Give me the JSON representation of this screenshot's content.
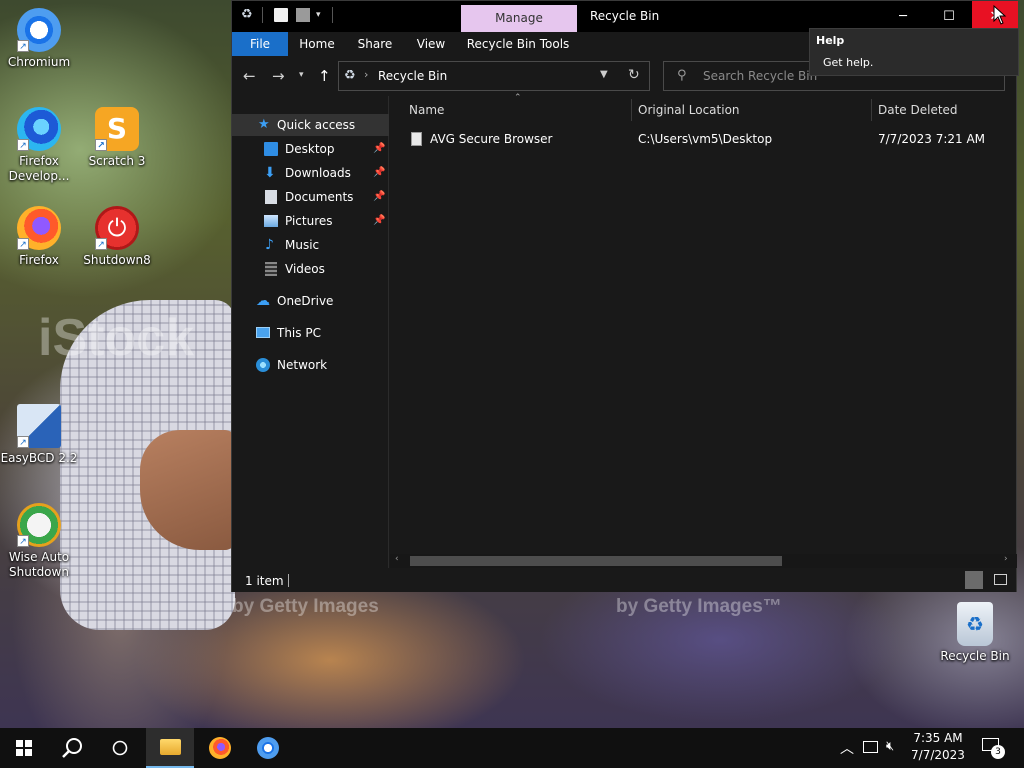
{
  "desktop": {
    "icons": [
      {
        "label": "Chromium"
      },
      {
        "label": "Firefox Develop..."
      },
      {
        "label": "Scratch 3"
      },
      {
        "label": "Firefox"
      },
      {
        "label": "Shutdown8"
      },
      {
        "label": "EasyBCD 2.2"
      },
      {
        "label": "Wise Auto Shutdown"
      },
      {
        "label": "Recycle Bin"
      }
    ],
    "watermarks": [
      "iStock",
      "by Getty Images",
      "by Getty Images™"
    ]
  },
  "window": {
    "title": "Recycle Bin",
    "context_tab": "Manage",
    "ribbon_tabs": [
      "File",
      "Home",
      "Share",
      "View",
      "Recycle Bin Tools"
    ],
    "address": "Recycle Bin",
    "search_placeholder": "Search Recycle Bin",
    "nav": {
      "quick_access": "Quick access",
      "items": [
        "Desktop",
        "Downloads",
        "Documents",
        "Pictures",
        "Music",
        "Videos"
      ],
      "onedrive": "OneDrive",
      "this_pc": "This PC",
      "network": "Network"
    },
    "columns": [
      "Name",
      "Original Location",
      "Date Deleted"
    ],
    "rows": [
      {
        "name": "AVG Secure Browser",
        "location": "C:\\Users\\vm5\\Desktop",
        "date": "7/7/2023 7:21 AM"
      }
    ],
    "status": "1 item"
  },
  "tooltip": {
    "title": "Help",
    "text": "Get help."
  },
  "taskbar": {
    "time": "7:35 AM",
    "date": "7/7/2023",
    "notifications": "3"
  },
  "colors": {
    "accent": "#1a6fc9",
    "manage_tab": "#e6c6ee",
    "close_hover": "#e81123"
  }
}
